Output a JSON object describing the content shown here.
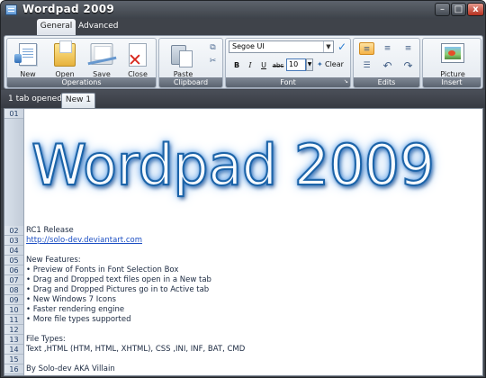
{
  "window": {
    "title": "Wordpad 2009",
    "controls": {
      "minimize": "–",
      "maximize": "□",
      "close": "x"
    }
  },
  "ribbon": {
    "tabs": [
      "General",
      "Advanced"
    ],
    "groups": {
      "operations": {
        "label": "Operations",
        "buttons": [
          "New",
          "Open",
          "Save",
          "Close"
        ]
      },
      "clipboard": {
        "label": "Clipboard",
        "paste": "Paste"
      },
      "font": {
        "label": "Font",
        "family": "Segoe UI",
        "size": "10",
        "bold": "B",
        "italic": "I",
        "underline": "U",
        "strike": "abc",
        "clear": "Clear"
      },
      "edits": {
        "label": "Edits"
      },
      "insert": {
        "label": "Insert",
        "picture": "Picture"
      }
    },
    "icons": {
      "new": "new-document-icon",
      "open": "open-folder-icon",
      "save": "save-icon",
      "close": "close-document-icon",
      "paste": "clipboard-paste-icon",
      "cut": "scissors-icon",
      "copy": "copy-icon",
      "picture": "picture-icon",
      "check": "checkmark-icon",
      "undo": "undo-icon",
      "redo": "redo-icon"
    },
    "accent": "#f5b348"
  },
  "documentTabs": {
    "count_label": "1 tab opened",
    "tabs": [
      "New 1"
    ]
  },
  "editor": {
    "line_numbers": [
      "01",
      "02",
      "03",
      "04",
      "05",
      "06",
      "07",
      "08",
      "09",
      "10",
      "11",
      "12",
      "13",
      "14",
      "15",
      "16"
    ],
    "lines": {
      "title": "Wordpad 2009",
      "l02": "RC1 Release",
      "l03": "http://solo-dev.deviantart.com",
      "l04": "",
      "l05": "New Features:",
      "l06": "• Preview of Fonts in Font Selection Box",
      "l07": "• Drag and Dropped text files open in a New tab",
      "l08": "• Drag and Dropped Pictures go in to Active tab",
      "l09": "• New Windows 7 Icons",
      "l10": "• Faster rendering engine",
      "l11": "• More file types supported",
      "l12": "",
      "l13": "File Types:",
      "l14": "Text ,HTML (HTM, HTML, XHTML), CSS ,INI, INF, BAT, CMD",
      "l15": "",
      "l16": "By Solo-dev AKA Villain"
    },
    "link_color": "#1b4ec3",
    "title_color": "#1b63a8"
  }
}
